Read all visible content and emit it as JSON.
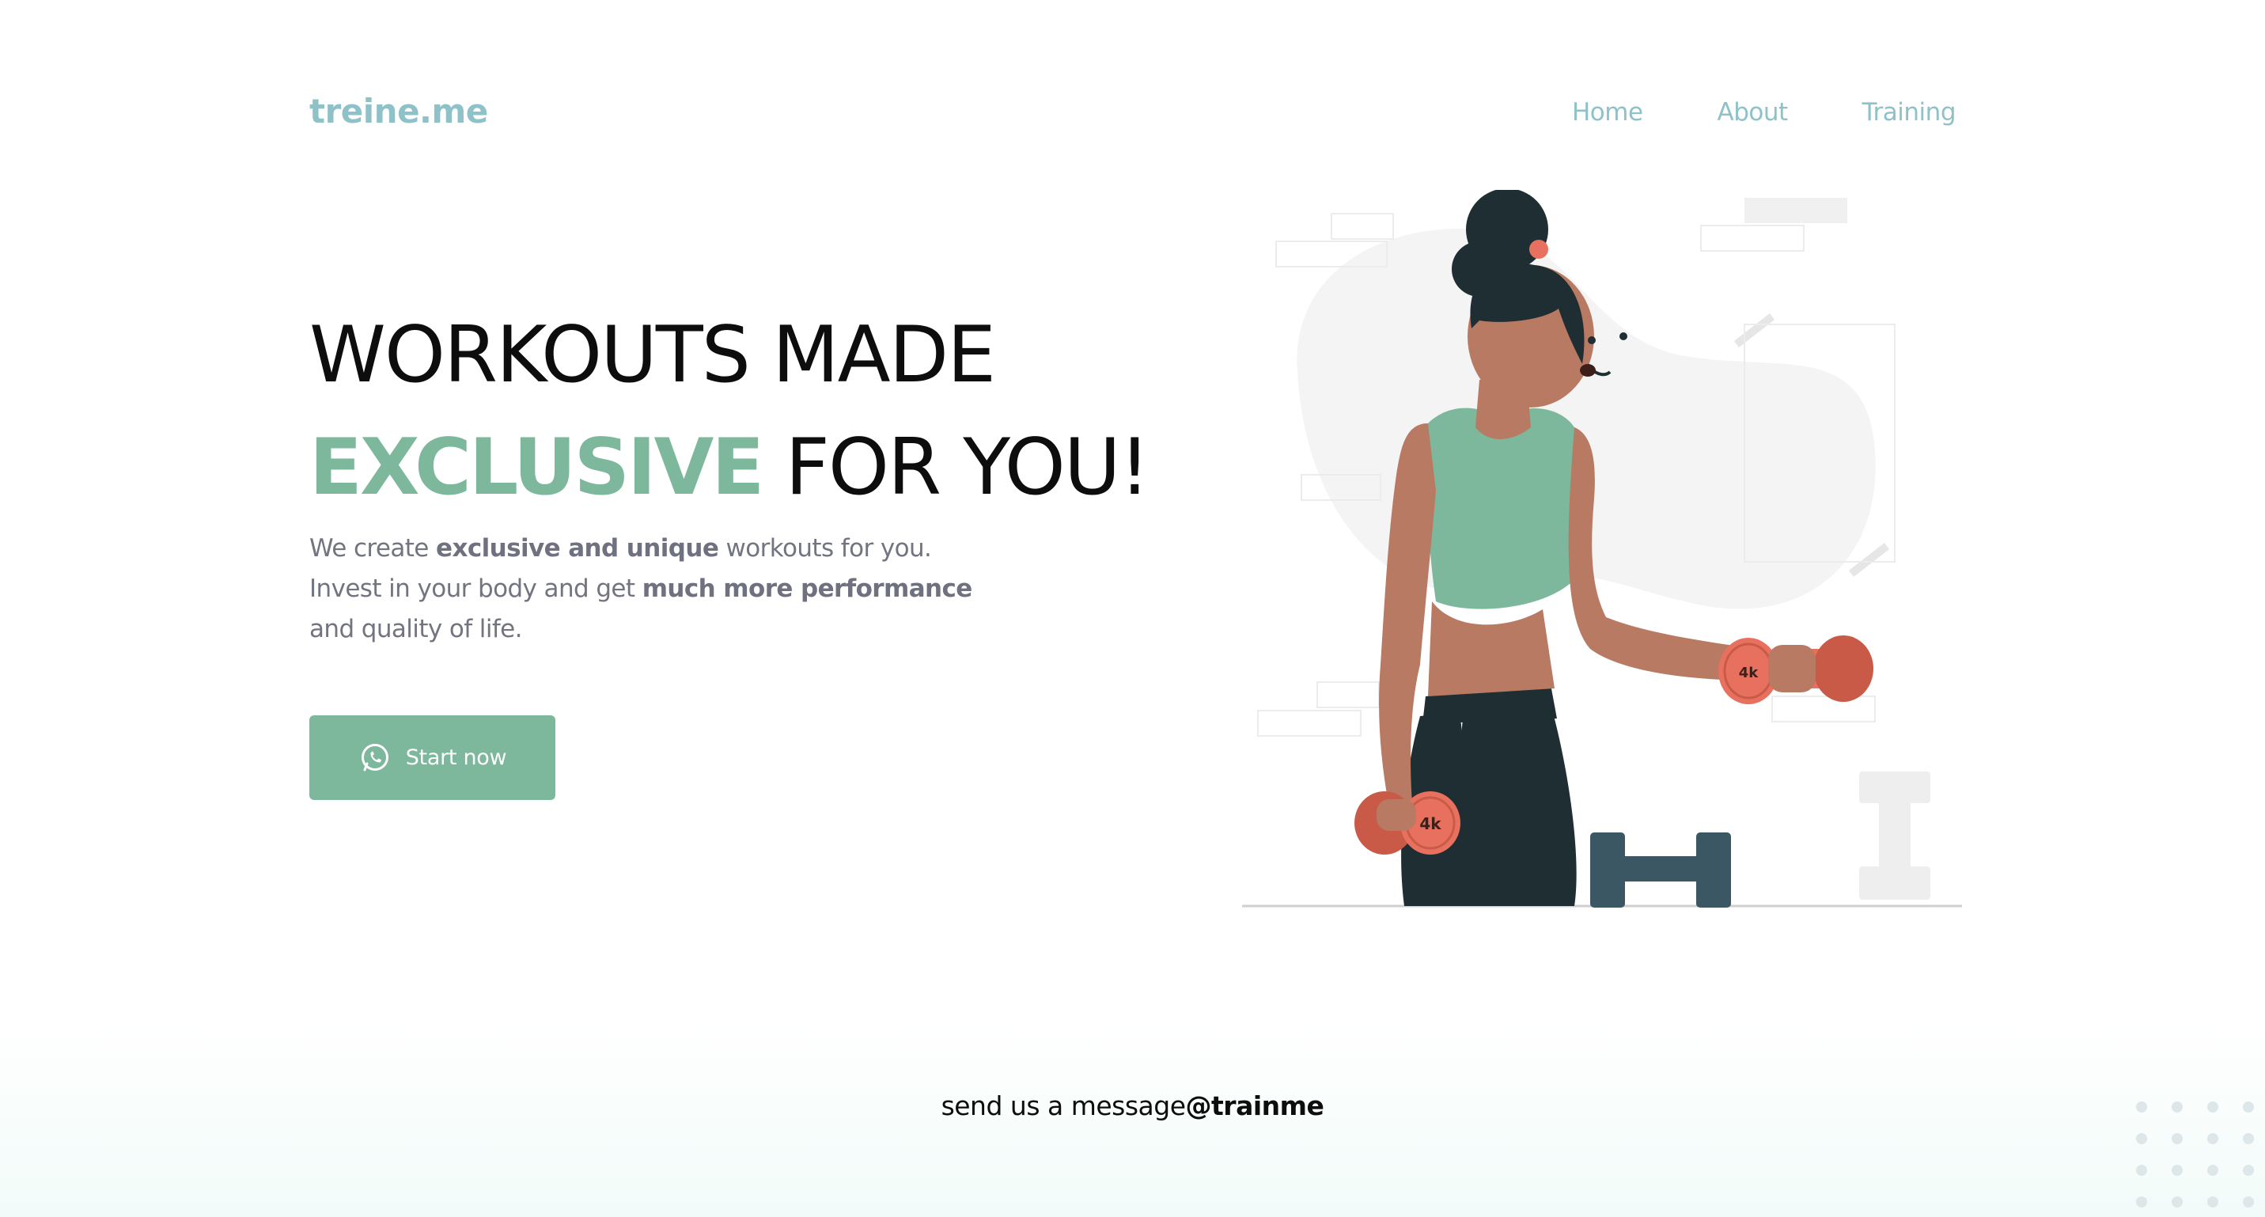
{
  "header": {
    "logo": "treine.me",
    "nav": [
      "Home",
      "About",
      "Training"
    ]
  },
  "hero": {
    "headline_line1": "WORKOUTS MADE",
    "headline_accent": "EXCLUSIVE",
    "headline_rest": "FOR YOU!",
    "desc_1": "We create ",
    "desc_bold_1": "exclusive and unique",
    "desc_2": " workouts for you.",
    "desc_3": "Invest in your body and get ",
    "desc_bold_2": "much more performance",
    "desc_4": "and quality of life.",
    "cta_label": "Start now",
    "cta_icon": "whatsapp-icon",
    "dumbbell_label": "4k"
  },
  "footer": {
    "message": "send us a message",
    "handle": "@trainme"
  },
  "colors": {
    "accent": "#7db89d",
    "nav": "#8fc1c9",
    "text": "#0d0d0d",
    "muted": "#727480",
    "skin": "#b87a62",
    "hair": "#1f2e33",
    "dumbbell": "#e8705e"
  }
}
